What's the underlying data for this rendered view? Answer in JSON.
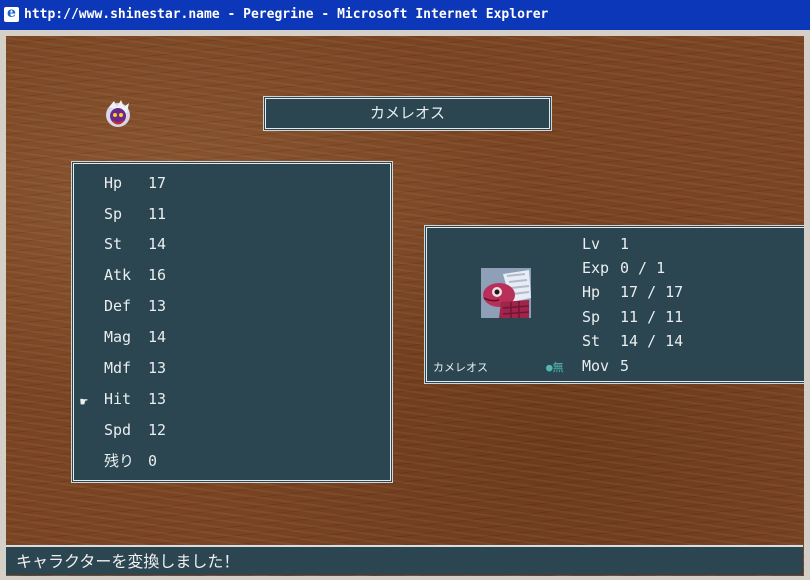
{
  "window": {
    "title": "http://www.shinestar.name - Peregrine - Microsoft Internet Explorer"
  },
  "character": {
    "name": "カメレオス"
  },
  "stats": [
    {
      "label": "Hp",
      "value": "17"
    },
    {
      "label": "Sp",
      "value": "11"
    },
    {
      "label": "St",
      "value": "14"
    },
    {
      "label": "Atk",
      "value": "16"
    },
    {
      "label": "Def",
      "value": "13"
    },
    {
      "label": "Mag",
      "value": "14"
    },
    {
      "label": "Mdf",
      "value": "13"
    },
    {
      "label": "Hit",
      "value": "13"
    },
    {
      "label": "Spd",
      "value": "12"
    },
    {
      "label": "残り",
      "value": "0"
    }
  ],
  "selected_stat": "Hit",
  "info": {
    "unit_name": "カメレオス",
    "element": "●無",
    "rows": [
      {
        "label": "Lv",
        "value": "1"
      },
      {
        "label": "Exp",
        "value": "0 / 1"
      },
      {
        "label": "Hp",
        "value": "17 / 17"
      },
      {
        "label": "Sp",
        "value": "11 / 11"
      },
      {
        "label": "St",
        "value": "14 / 14"
      },
      {
        "label": "Mov",
        "value": "5"
      }
    ]
  },
  "message": "キャラクターを変換しました！",
  "icons": {
    "window": "ie-icon",
    "sprite": "character-sprite-icon",
    "portrait": "chameleon-portrait-icon",
    "pointer": "pointing-hand-icon"
  }
}
